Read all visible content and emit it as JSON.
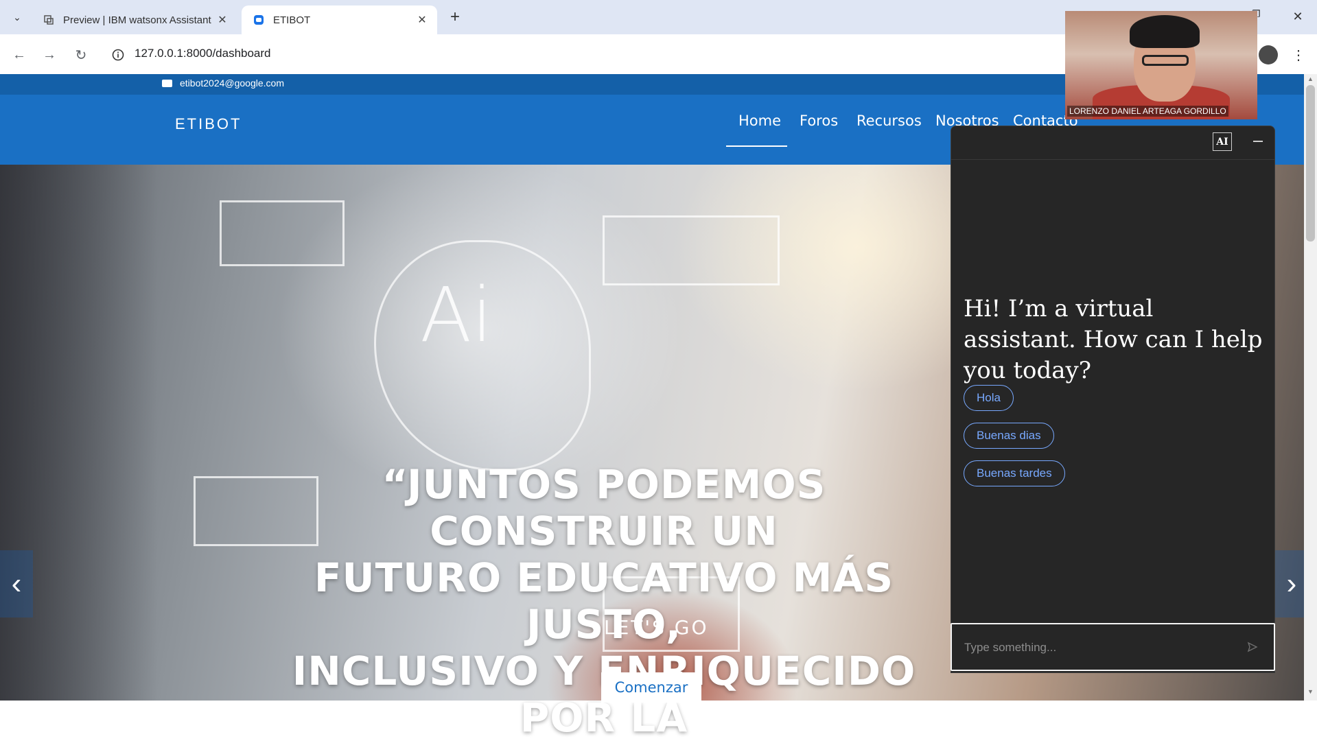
{
  "browser": {
    "tabs": [
      {
        "label": "Preview | IBM watsonx Assistant",
        "active": false
      },
      {
        "label": "ETIBOT",
        "active": true
      }
    ],
    "address": "127.0.0.1:8000/dashboard"
  },
  "site": {
    "email": "etibot2024@google.com",
    "brand": "ETIBOT",
    "nav": [
      {
        "label": "Home",
        "active": true
      },
      {
        "label": "Foros"
      },
      {
        "label": "Recursos"
      },
      {
        "label": "Nosotros"
      },
      {
        "label": "Contacto"
      }
    ],
    "hero": {
      "ai_graphic_text": "Ai",
      "quote_lines": [
        "“JUNTOS PODEMOS CONSTRUIR UN",
        "FUTURO EDUCATIVO MÁS JUSTO,",
        "INCLUSIVO Y ENRIQUECIDO POR LA"
      ],
      "subtitle": "LET'S GO",
      "cta": "Comenzar"
    }
  },
  "video": {
    "participant_name": "LORENZO DANIEL ARTEAGA GORDILLO"
  },
  "chat": {
    "badge": "AI",
    "greeting": "Hi! I’m a virtual assistant. How can I help you today?",
    "options": [
      "Hola",
      "Buenas dias",
      "Buenas tardes"
    ],
    "input_placeholder": "Type something...",
    "colors": {
      "background": "#262626",
      "accent": "#78a9ff"
    }
  },
  "colors": {
    "header": "#1a70c4",
    "topbar": "#1460a8"
  }
}
